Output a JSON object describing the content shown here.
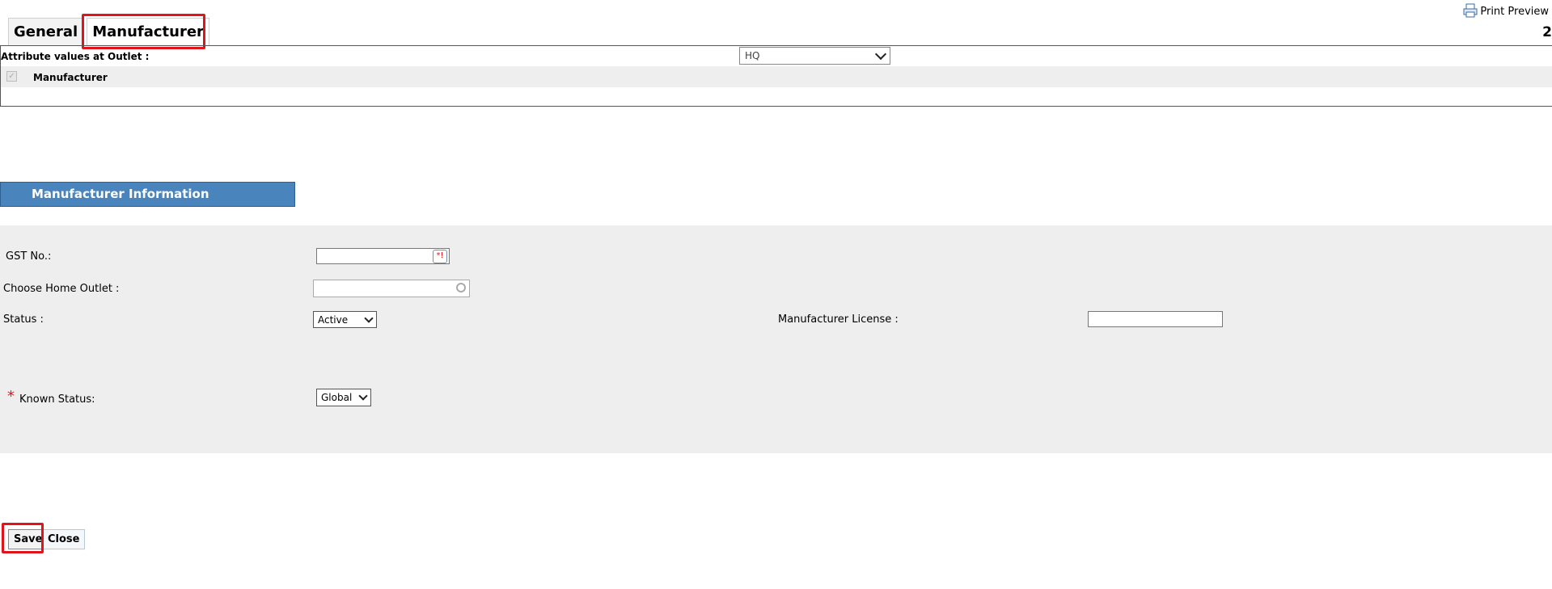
{
  "toolbar": {
    "print_preview": "Print Preview",
    "page_number": "2"
  },
  "tabs": [
    {
      "label": "General",
      "active": false
    },
    {
      "label": "Manufacturer",
      "active": true
    }
  ],
  "attributes": {
    "label": "Attribute values at Outlet :",
    "outlet_value": "HQ",
    "row_label": "Manufacturer",
    "row_checked": true
  },
  "section": {
    "title": "Manufacturer Information"
  },
  "form": {
    "gst_label": "GST No.:",
    "gst_value": "",
    "gst_badge": "*!",
    "home_outlet_label": "Choose Home Outlet :",
    "home_outlet_value": "",
    "status_label": "Status :",
    "status_value": "Active",
    "license_label": "Manufacturer License :",
    "license_value": "",
    "known_status_label": "Known Status:",
    "known_status_value": "Global",
    "required_mark": "*"
  },
  "buttons": {
    "save": "Save",
    "close": "Close"
  },
  "colors": {
    "section_header": "#4a84bc",
    "highlight": "#e3131b",
    "panel_bg": "#eeeeee"
  }
}
